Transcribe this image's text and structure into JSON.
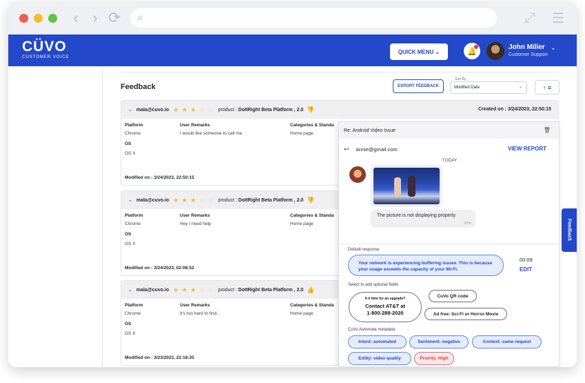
{
  "browser": {
    "nav_back": "‹",
    "nav_forward": "›",
    "nav_reload": "⟳",
    "search_icon": "⌕",
    "expand_icon": "⤢",
    "menu_icon": "☰"
  },
  "app": {
    "logo": "CÜVO",
    "logo_sub": "CUSTOMER VOICE",
    "brand_color": "#2348c9"
  },
  "header": {
    "quick_menu": "QUICK MENU ⌄",
    "user_name": "John Miller",
    "user_role": "Customer Support",
    "user_caret": "⌄"
  },
  "feedback": {
    "title": "Feedback",
    "export_label": "EXPORT FEEDBACK",
    "sort_by_label": "Sort By",
    "sort_value": "Modified Date",
    "sort_caret": "⌄",
    "sort_icon": "↑ ≡",
    "cards": [
      {
        "email": "mala@cuvo.io",
        "stars_filled": "★ ★ ★",
        "stars_empty": "☆ ☆",
        "product_label": "product :",
        "product": "DoItRight Beta Platform , 2.0",
        "thumb": "👎",
        "created": "Created on : 3/24/2023, 22:50:15",
        "platform_h": "Platform",
        "platform_v": "Chrome",
        "remarks_h": "User Remarks",
        "remarks_v": "I would like someone to call me",
        "cat_h": "Categories & Standa",
        "cat_v": "Home page",
        "os_h": "OS",
        "os_v": "OS X",
        "modified": "Modified on : 3/24/2023, 22:50:15"
      },
      {
        "email": "mala@cuvo.io",
        "stars_filled": "★ ★ ★",
        "stars_empty": "☆ ☆",
        "product_label": "product :",
        "product": "DoItRight Beta Platform , 2.0",
        "thumb": "👎",
        "created": "",
        "platform_h": "Platform",
        "platform_v": "Chrome",
        "remarks_h": "User Remarks",
        "remarks_v": "Hey I need help",
        "cat_h": "Categories & Standa",
        "cat_v": "Home page",
        "os_h": "OS",
        "os_v": "OS X",
        "modified": "Modified on : 3/24/2023, 02:08:52"
      },
      {
        "email": "mala@cuvo.io",
        "stars_filled": "★ ★ ★",
        "stars_empty": "☆ ☆",
        "product_label": "product :",
        "product": "DoItRight Beta Platform , 2.0",
        "thumb": "👍",
        "created": "",
        "platform_h": "Platform",
        "platform_v": "Chrome",
        "remarks_h": "User Remarks",
        "remarks_v": "It's too hard to find..",
        "cat_h": "Categories & Standa",
        "cat_v": "Home page",
        "os_h": "OS",
        "os_v": "OS X",
        "modified": "Modified on : 3/23/2023, 22:18:35"
      }
    ]
  },
  "panel": {
    "subject": "Re: Android Video Issue",
    "trash_icon": "🗑",
    "reply_icon": "↩",
    "from": "annie@gmail.com",
    "view_report": "VIEW REPORT",
    "today": "TODAY",
    "message": "The picture is not displaying properly",
    "message_time": "37m",
    "default_response_label": "Default response",
    "default_response": "Your network is experiencing buffering issues.  This is because your usage exceeds the capacity of your Wi-Fi.",
    "response_time": "00:09",
    "edit_label": "EDIT",
    "optional_label": "Select to add optional fields",
    "upgrade_line1": "It it time for an upgrade?",
    "upgrade_line2": "Contact AT&T at",
    "upgrade_line3": "1-800-288-2020",
    "qr_code": "CuVo QR code",
    "ad_free": "Ad free: Sci-Fi or Horror Movie",
    "metadata_label": "CuVo Automate metadata",
    "meta": {
      "intent": "Intent: automated",
      "sentiment": "Sentiment: negative",
      "context": "Context: same request",
      "entity": "Entity: video quality",
      "priority": "Priority: High"
    }
  },
  "feedback_tab": "Feedback"
}
